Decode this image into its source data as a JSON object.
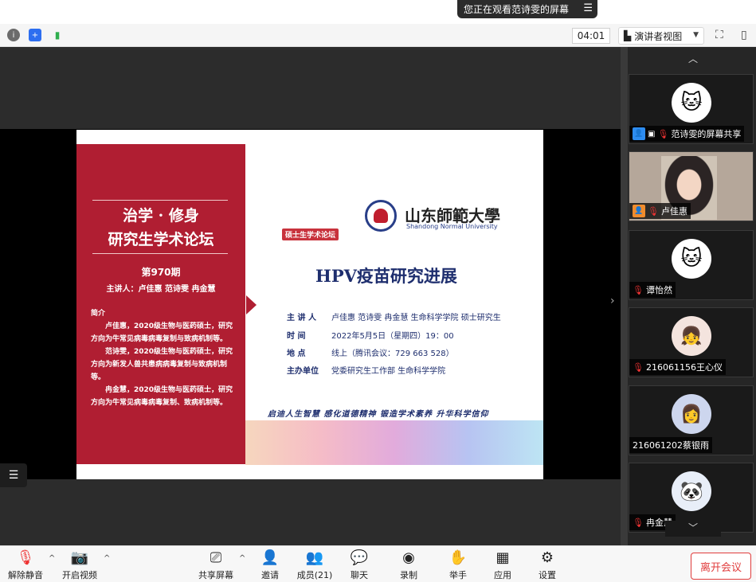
{
  "topbar": {
    "share_notice": "您正在观看范诗雯的屏幕",
    "menu_icon": "menu-icon"
  },
  "toolbar": {
    "timer": "04:01",
    "view_mode": "演讲者视图",
    "icons": [
      "info-icon",
      "shield-icon",
      "signal-icon",
      "fullscreen-icon",
      "sidebar-toggle-icon"
    ]
  },
  "slide": {
    "motto_line1": "治学 · 修身",
    "motto_line2": "研究生学术论坛",
    "issue": "第970期",
    "speakers": "主讲人：卢佳惠 范诗雯 冉金慧",
    "intro_title": "简介",
    "intro": [
      "卢佳惠，2020级生物与医药硕士，研究方向为牛常见病毒病毒复制与致病机制等。",
      "范诗雯，2020级生物与医药硕士，研究方向为新发人兽共患病病毒复制与致病机制等。",
      "冉金慧，2020级生物与医药硕士，研究方向为牛常见病毒病毒复制、致病机制等。"
    ],
    "badge": "硕士生学术论坛",
    "university_cn": "山东師範大學",
    "university_en": "Shandong Normal University",
    "title": "HPV疫苗研究进展",
    "info": [
      {
        "key": "主 讲 人",
        "value": "卢佳惠 范诗雯 冉金慧 生命科学学院 硕士研究生"
      },
      {
        "key": "时    间",
        "value": "2022年5月5日（星期四）19：00"
      },
      {
        "key": "地    点",
        "value": "线上（腾讯会议：729 663 528）"
      },
      {
        "key": "主办单位",
        "value": "党委研究生工作部 生命科学学院"
      }
    ],
    "slogan": "启迪人生智慧  感化道德精神  锻造学术素养  升华科学信仰"
  },
  "gallery": {
    "participants": [
      {
        "name": "范诗雯的屏幕共享",
        "avatar": "cat-avatar",
        "host": true,
        "sharing": true
      },
      {
        "name": "卢佳惠",
        "avatar": "video-feed",
        "host": true,
        "sharing": false
      },
      {
        "name": "谭怡然",
        "avatar": "cat-avatar",
        "host": false,
        "sharing": false
      },
      {
        "name": "216061156王心仪",
        "avatar": "anime-avatar",
        "host": false,
        "sharing": false
      },
      {
        "name": "216061202蔡银雨",
        "avatar": "anime-avatar",
        "host": false,
        "sharing": false
      },
      {
        "name": "冉金慧",
        "avatar": "cartoon-avatar",
        "host": false,
        "sharing": false
      }
    ]
  },
  "bottombar": {
    "items": [
      {
        "label": "解除静音",
        "icon": "mic-off-icon"
      },
      {
        "label": "开启视频",
        "icon": "camera-off-icon"
      },
      {
        "label": "共享屏幕",
        "icon": "share-screen-icon"
      },
      {
        "label": "邀请",
        "icon": "invite-icon"
      },
      {
        "label": "成员(21)",
        "icon": "members-icon"
      },
      {
        "label": "聊天",
        "icon": "chat-icon"
      },
      {
        "label": "录制",
        "icon": "record-icon"
      },
      {
        "label": "举手",
        "icon": "raise-hand-icon"
      },
      {
        "label": "应用",
        "icon": "apps-icon"
      },
      {
        "label": "设置",
        "icon": "settings-icon"
      }
    ],
    "leave": "离开会议"
  }
}
